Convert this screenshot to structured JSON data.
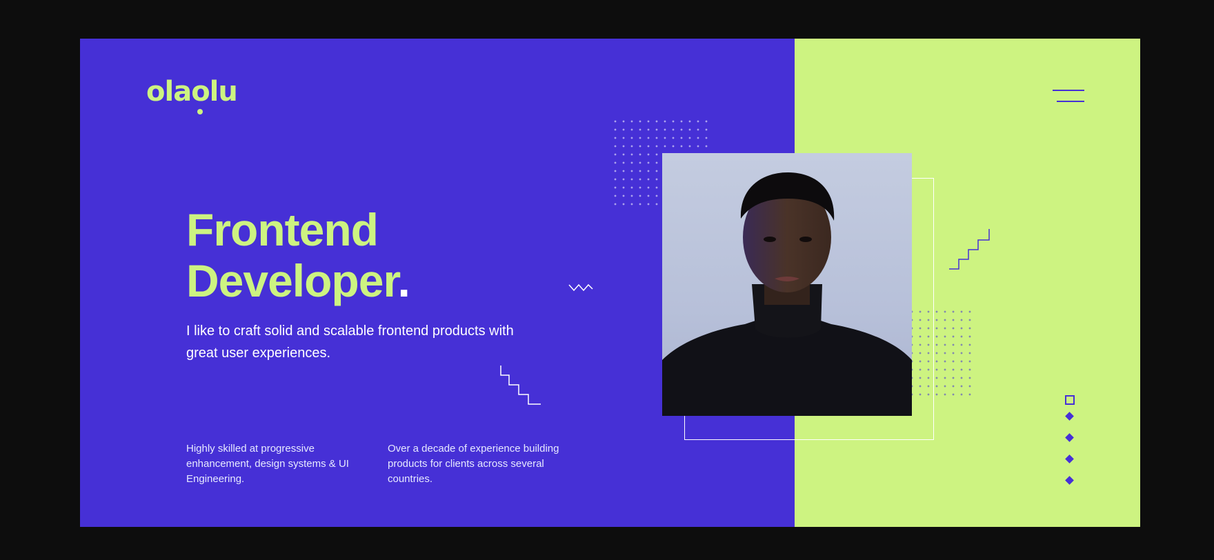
{
  "brand": {
    "logo_pre": "ola",
    "logo_o": "o",
    "logo_post": "lu"
  },
  "hero": {
    "headline_line1": "Frontend",
    "headline_line2": "Developer",
    "headline_period": ".",
    "tagline": "I like to craft solid and scalable frontend products with great user experiences."
  },
  "features": [
    {
      "text": "Highly skilled at progressive enhancement, design systems & UI Engineering."
    },
    {
      "text": "Over a decade of experience building products for clients across several countries."
    }
  ],
  "side_nav": {
    "square": "outline-square",
    "diamonds": 4
  },
  "colors": {
    "primary_purple": "#4630d6",
    "accent_lime": "#cdf381",
    "page_bg": "#0d0d0d",
    "text_white": "#ffffff"
  },
  "icons": {
    "menu": "hamburger-menu-icon",
    "nav_square": "square-outline-icon",
    "nav_diamond": "diamond-icon"
  }
}
